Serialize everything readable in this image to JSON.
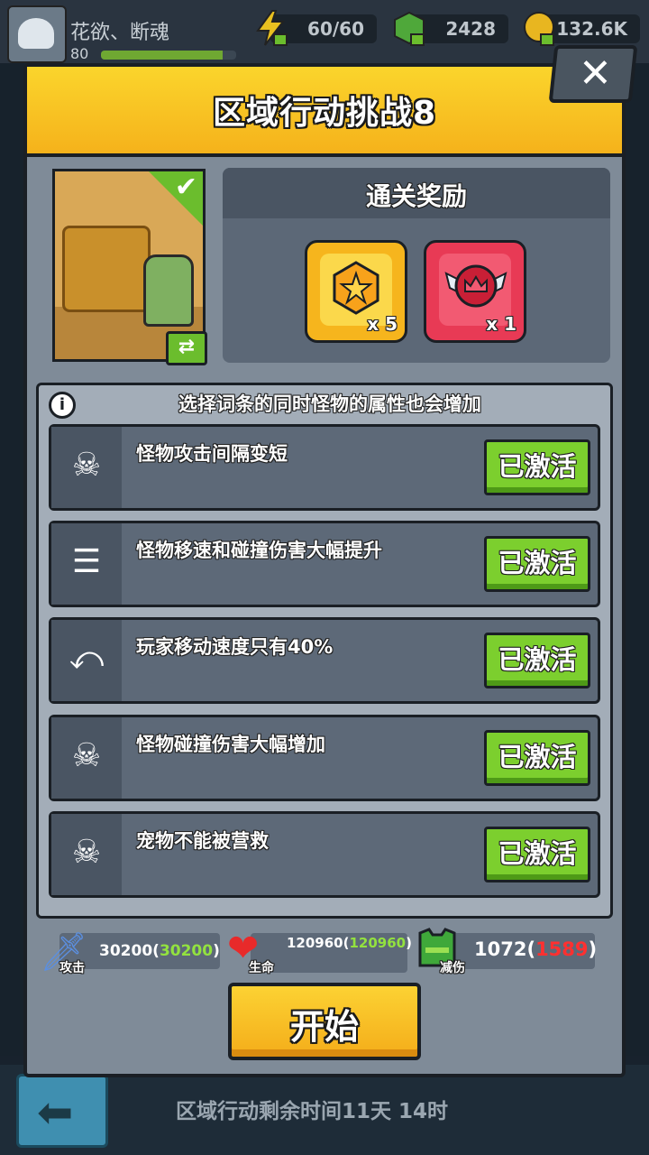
{
  "topbar": {
    "player_name": "花欲、断魂",
    "player_level": "80",
    "energy": "60/60",
    "gems": "2428",
    "gold": "132.6K"
  },
  "modal": {
    "title": "区域行动挑战8",
    "close_label": "✕",
    "reward_title": "通关奖励",
    "rewards": [
      {
        "qty": "x 5",
        "icon": "star-hexagon-icon"
      },
      {
        "qty": "x 1",
        "icon": "winged-crown-badge-icon"
      }
    ],
    "conditions_hint": "选择词条的同时怪物的属性也会增加",
    "conditions": [
      {
        "text": "怪物攻击间隔变短",
        "button": "已激活",
        "icon": "monster-mask-icon"
      },
      {
        "text": "怪物移速和碰撞伤害大幅提升",
        "button": "已激活",
        "icon": "fast-ghost-icon"
      },
      {
        "text": "玩家移动速度只有40%",
        "button": "已激活",
        "icon": "slow-arrow-icon"
      },
      {
        "text": "怪物碰撞伤害大幅增加",
        "button": "已激活",
        "icon": "monster-mask-icon"
      },
      {
        "text": "宠物不能被营救",
        "button": "已激活",
        "icon": "monster-mask-icon"
      }
    ],
    "stats": {
      "attack_label": "攻击",
      "attack_value": "30200",
      "attack_bonus": "30200",
      "hp_label": "生命",
      "hp_value": "120960",
      "hp_bonus": "120960",
      "defense_label": "减伤",
      "defense_value": "1072",
      "defense_bonus": "1589"
    },
    "start_label": "开始"
  },
  "footer": {
    "remaining_time": "区域行动剩余时间11天 14时"
  },
  "colors": {
    "header_yellow": "#f8c824",
    "activate_green": "#7ccf2e",
    "bonus_green": "#93e23f",
    "bonus_red": "#ff3030"
  }
}
